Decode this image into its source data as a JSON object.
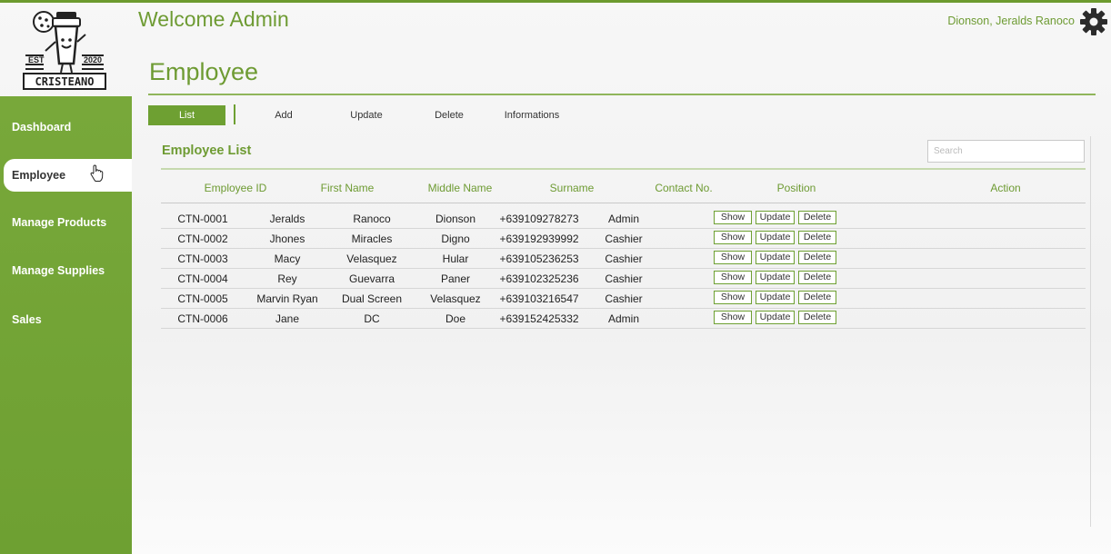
{
  "header": {
    "welcome": "Welcome Admin",
    "user_name": "Dionson, Jeralds Ranoco",
    "settings_icon": "gear-icon"
  },
  "logo": {
    "brand": "CRISTEANO",
    "est_label": "EST",
    "est_year": "2020"
  },
  "sidebar": {
    "items": [
      {
        "label": "Dashboard"
      },
      {
        "label": "Employee"
      },
      {
        "label": "Manage Products"
      },
      {
        "label": "Manage Supplies"
      },
      {
        "label": "Sales"
      }
    ],
    "active": "Employee"
  },
  "page": {
    "title": "Employee",
    "tabs": [
      {
        "label": "List"
      },
      {
        "label": "Add"
      },
      {
        "label": "Update"
      },
      {
        "label": "Delete"
      },
      {
        "label": "Informations"
      }
    ],
    "active_tab": "List"
  },
  "employee_list": {
    "title": "Employee List",
    "search_placeholder": "Search",
    "columns": [
      "Employee ID",
      "First Name",
      "Middle Name",
      "Surname",
      "Contact No.",
      "Position",
      "Action"
    ],
    "rows": [
      {
        "id": "CTN-0001",
        "first": "Jeralds",
        "middle": "Ranoco",
        "surname": "Dionson",
        "contact": "+639109278273",
        "position": "Admin"
      },
      {
        "id": "CTN-0002",
        "first": "Jhones",
        "middle": "Miracles",
        "surname": "Digno",
        "contact": "+639192939992",
        "position": "Cashier"
      },
      {
        "id": "CTN-0003",
        "first": "Macy",
        "middle": "Velasquez",
        "surname": "Hular",
        "contact": "+639105236253",
        "position": "Cashier"
      },
      {
        "id": "CTN-0004",
        "first": "Rey",
        "middle": "Guevarra",
        "surname": "Paner",
        "contact": "+639102325236",
        "position": "Cashier"
      },
      {
        "id": "CTN-0005",
        "first": "Marvin Ryan",
        "middle": "Dual Screen",
        "surname": "Velasquez",
        "contact": "+639103216547",
        "position": "Cashier"
      },
      {
        "id": "CTN-0006",
        "first": "Jane",
        "middle": "DC",
        "surname": "Doe",
        "contact": "+639152425332",
        "position": "Admin"
      }
    ],
    "actions": {
      "show": "Show",
      "update": "Update",
      "delete": "Delete"
    }
  },
  "colors": {
    "accent": "#6ea032",
    "accent_text": "#6e9b33",
    "background": "#f4f4f4"
  }
}
